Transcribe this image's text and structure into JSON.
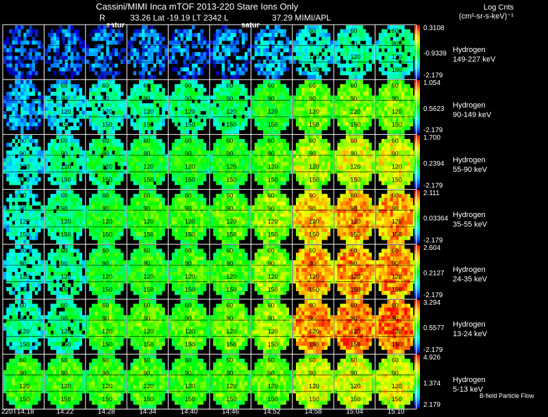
{
  "header": {
    "title": "Cassini/MIMI Inca mTOF  2013-220    Stare    Ions Only",
    "r_label": "R",
    "position": "33.26 Lat -19.19 LT 2342 L",
    "org": "37.29  MIMI/APL",
    "marker_1": "satur",
    "marker_2": "satur"
  },
  "units": {
    "line1": "Log Cnts",
    "line2": "(cm²-sr-s-keV)⁻¹"
  },
  "footer": {
    "flow_label": "B-field Particle Flow"
  },
  "time_ticks": [
    "220T14:18",
    "14:22",
    "14:28",
    "14:34",
    "14:40",
    "14:46",
    "14:52",
    "14:58",
    "15:04",
    "15:10"
  ],
  "image_grid_labels": [
    "60",
    "90",
    "120",
    "150"
  ],
  "colors": {
    "background": "#000000",
    "grid_line": "#ffffff"
  },
  "chart_data": {
    "type": "heatmap",
    "title": "Cassini/MIMI Inca mTOF  2013-220    Stare    Ions Only",
    "colorbar_label": "Log Cnts (cm²-sr-s-keV)⁻¹",
    "colormap": "rainbow (blue low → red high)",
    "x_ticks": [
      "220T14:18",
      "14:22",
      "14:28",
      "14:34",
      "14:40",
      "14:46",
      "14:52",
      "14:58",
      "15:04",
      "15:10"
    ],
    "rows": [
      {
        "species": "Hydrogen",
        "energy": "149-227 keV",
        "cbar_max": "0.3108",
        "cbar_mid": "-0.9339",
        "cbar_min": "-2.179",
        "frame_levels": [
          0.1,
          0.12,
          0.12,
          0.14,
          0.14,
          0.15,
          0.2,
          0.3,
          0.35,
          0.35
        ]
      },
      {
        "species": "Hydrogen",
        "energy": "90-149 keV",
        "cbar_max": "1.054",
        "cbar_mid": "0.5623",
        "cbar_min": "-2.179",
        "frame_levels": [
          0.2,
          0.28,
          0.35,
          0.38,
          0.4,
          0.42,
          0.5,
          0.6,
          0.62,
          0.62
        ]
      },
      {
        "species": "Hydrogen",
        "energy": "55-90 keV",
        "cbar_max": "1.700",
        "cbar_mid": "0.2394",
        "cbar_min": "-2.179",
        "frame_levels": [
          0.3,
          0.38,
          0.44,
          0.48,
          0.5,
          0.52,
          0.58,
          0.68,
          0.72,
          0.72
        ]
      },
      {
        "species": "Hydrogen",
        "energy": "35-55 keV",
        "cbar_max": "2.111",
        "cbar_mid": "0.03364",
        "cbar_min": "-2.179",
        "frame_levels": [
          0.32,
          0.42,
          0.5,
          0.54,
          0.56,
          0.58,
          0.66,
          0.8,
          0.84,
          0.84
        ]
      },
      {
        "species": "Hydrogen",
        "energy": "24-35 keV",
        "cbar_max": "2.604",
        "cbar_mid": "0.2127",
        "cbar_min": "-2.179",
        "frame_levels": [
          0.32,
          0.38,
          0.5,
          0.52,
          0.54,
          0.56,
          0.64,
          0.84,
          0.86,
          0.86
        ]
      },
      {
        "species": "Hydrogen",
        "energy": "13-24 keV",
        "cbar_max": "3.294",
        "cbar_mid": "0.5577",
        "cbar_min": "-2.179",
        "frame_levels": [
          0.36,
          0.4,
          0.56,
          0.58,
          0.58,
          0.6,
          0.66,
          0.86,
          0.9,
          0.9
        ]
      },
      {
        "species": "Hydrogen",
        "energy": "5-13 keV",
        "cbar_max": "4.926",
        "cbar_mid": "1.374",
        "cbar_min": "2.179",
        "frame_levels": [
          0.55,
          0.55,
          0.56,
          0.56,
          0.56,
          0.58,
          0.6,
          0.7,
          0.72,
          0.72
        ]
      }
    ]
  }
}
